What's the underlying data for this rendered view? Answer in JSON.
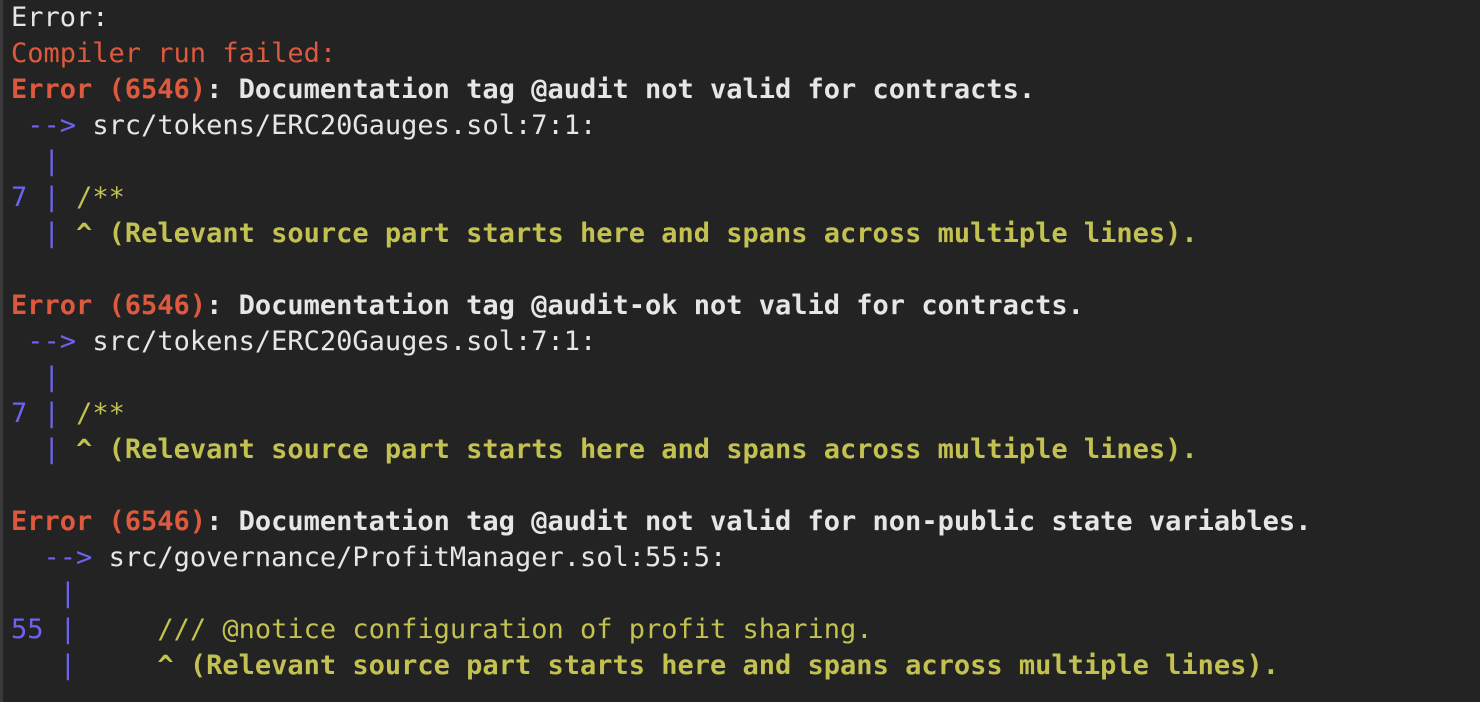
{
  "header": {
    "error_label": "Error:",
    "compiler_failed": "Compiler run failed:"
  },
  "errors": [
    {
      "title_prefix": "Error (6546)",
      "message": ": Documentation tag @audit not valid for contracts.",
      "arrow": "-->",
      "location": "src/tokens/ERC20Gauges.sol:7:1:",
      "bar": "|",
      "line_number": "7",
      "source": "/**",
      "note": "^ (Relevant source part starts here and spans across multiple lines)."
    },
    {
      "title_prefix": "Error (6546)",
      "message": ": Documentation tag @audit-ok not valid for contracts.",
      "arrow": "-->",
      "location": "src/tokens/ERC20Gauges.sol:7:1:",
      "bar": "|",
      "line_number": "7",
      "source": "/**",
      "note": "^ (Relevant source part starts here and spans across multiple lines)."
    },
    {
      "title_prefix": "Error (6546)",
      "message": ": Documentation tag @audit not valid for non-public state variables.",
      "arrow": "-->",
      "location": "src/governance/ProfitManager.sol:55:5:",
      "bar": "|",
      "line_number": "55",
      "source": "/// @notice configuration of profit sharing.",
      "note": "^ (Relevant source part starts here and spans across multiple lines)."
    }
  ],
  "colors": {
    "background": "#232323",
    "error_red": "#dd5a3e",
    "gutter_blue": "#6e63f0",
    "source_yellow": "#c3c150",
    "text_white": "#e6e6e6"
  }
}
